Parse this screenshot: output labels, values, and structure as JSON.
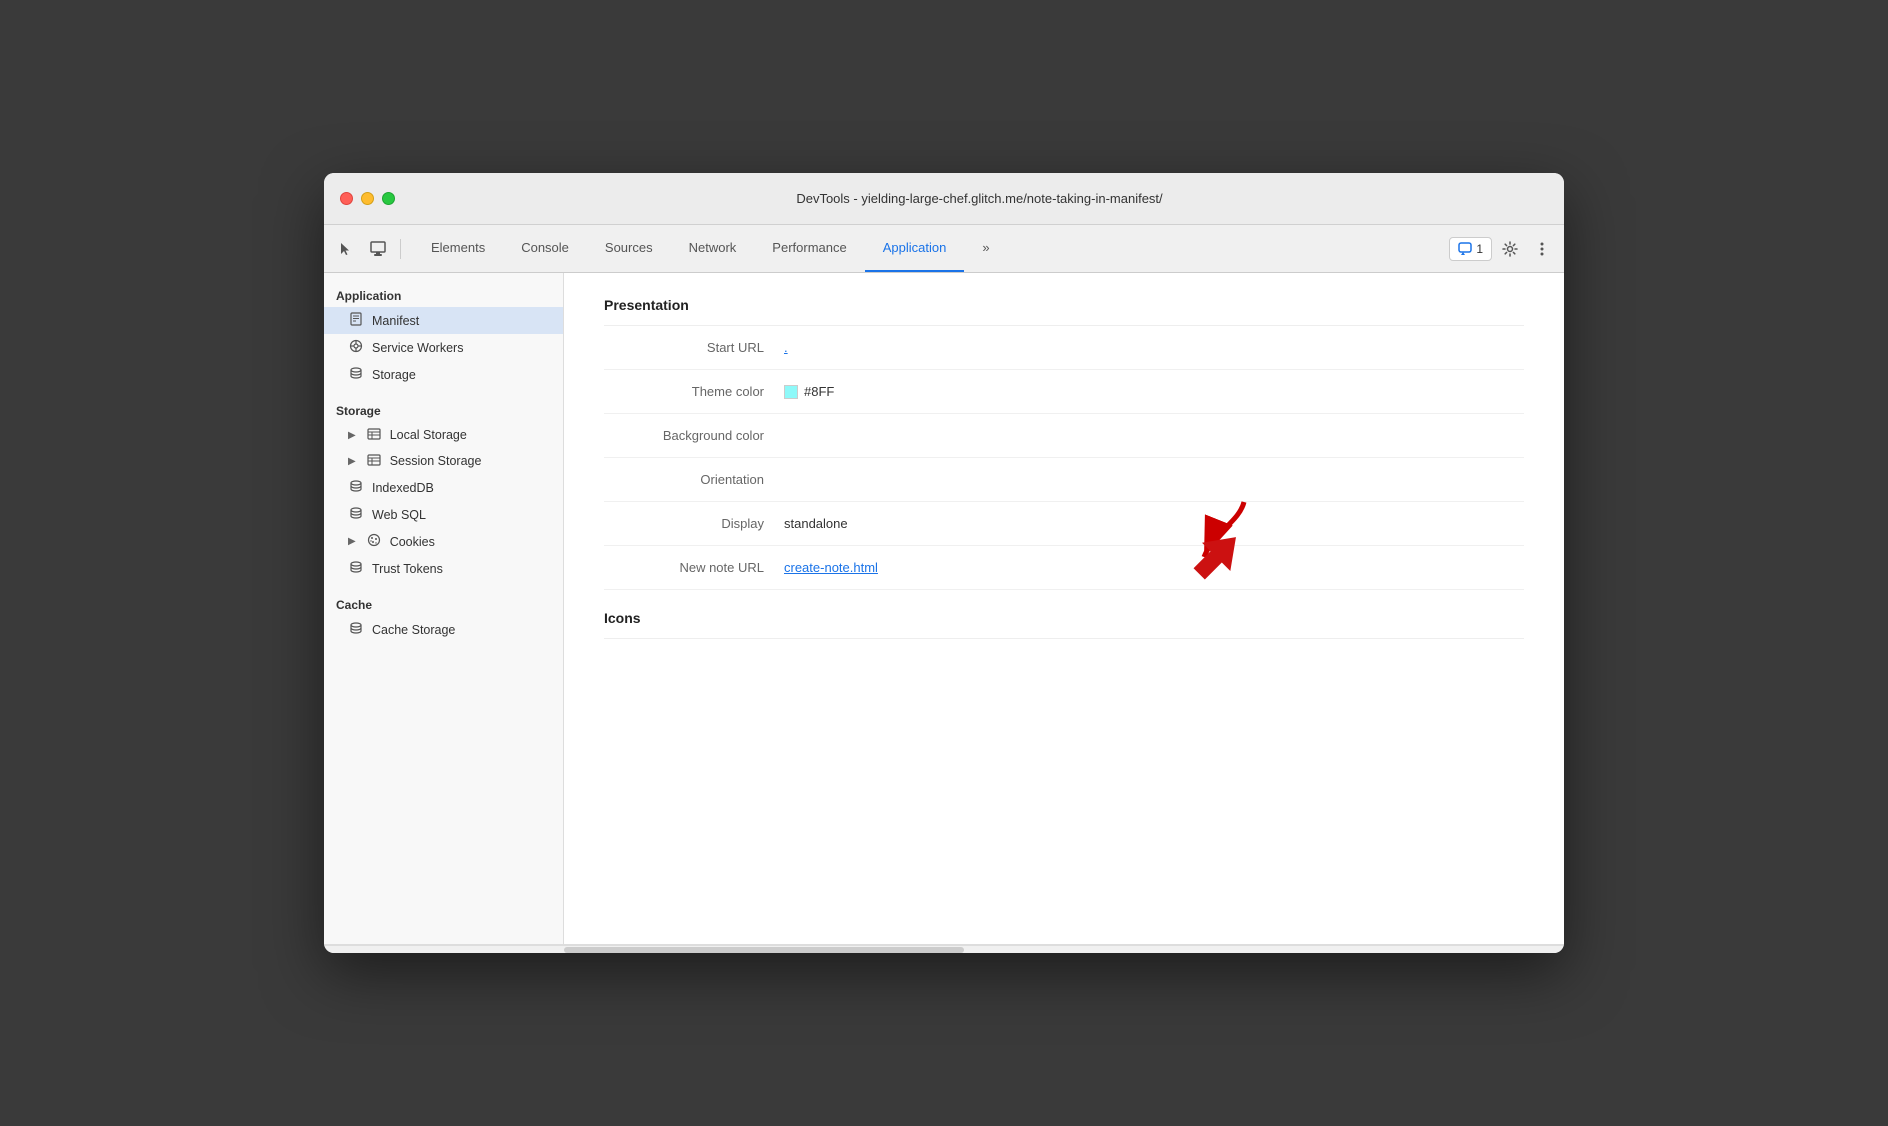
{
  "window": {
    "title": "DevTools - yielding-large-chef.glitch.me/note-taking-in-manifest/"
  },
  "toolbar": {
    "tabs": [
      {
        "id": "elements",
        "label": "Elements",
        "active": false
      },
      {
        "id": "console",
        "label": "Console",
        "active": false
      },
      {
        "id": "sources",
        "label": "Sources",
        "active": false
      },
      {
        "id": "network",
        "label": "Network",
        "active": false
      },
      {
        "id": "performance",
        "label": "Performance",
        "active": false
      },
      {
        "id": "application",
        "label": "Application",
        "active": true
      }
    ],
    "comments_count": "1",
    "more_label": "»"
  },
  "sidebar": {
    "sections": [
      {
        "id": "application",
        "label": "Application",
        "items": [
          {
            "id": "manifest",
            "label": "Manifest",
            "icon": "📄",
            "active": true,
            "indent": 1
          },
          {
            "id": "service-workers",
            "label": "Service Workers",
            "icon": "⚙️",
            "active": false,
            "indent": 1
          },
          {
            "id": "storage-app",
            "label": "Storage",
            "icon": "🗄️",
            "active": false,
            "indent": 1
          }
        ]
      },
      {
        "id": "storage",
        "label": "Storage",
        "items": [
          {
            "id": "local-storage",
            "label": "Local Storage",
            "icon": "▦",
            "active": false,
            "expandable": true,
            "indent": 1
          },
          {
            "id": "session-storage",
            "label": "Session Storage",
            "icon": "▦",
            "active": false,
            "expandable": true,
            "indent": 1
          },
          {
            "id": "indexeddb",
            "label": "IndexedDB",
            "icon": "🗄️",
            "active": false,
            "indent": 1
          },
          {
            "id": "web-sql",
            "label": "Web SQL",
            "icon": "🗄️",
            "active": false,
            "indent": 1
          },
          {
            "id": "cookies",
            "label": "Cookies",
            "icon": "🍪",
            "active": false,
            "expandable": true,
            "indent": 1
          },
          {
            "id": "trust-tokens",
            "label": "Trust Tokens",
            "icon": "🗄️",
            "active": false,
            "indent": 1
          }
        ]
      },
      {
        "id": "cache",
        "label": "Cache",
        "items": [
          {
            "id": "cache-storage",
            "label": "Cache Storage",
            "icon": "🗄️",
            "active": false,
            "indent": 1
          }
        ]
      }
    ]
  },
  "panel": {
    "sections": [
      {
        "id": "presentation",
        "title": "Presentation",
        "fields": [
          {
            "id": "start-url",
            "label": "Start URL",
            "value": ".",
            "type": "link"
          },
          {
            "id": "theme-color",
            "label": "Theme color",
            "value": "#8FF",
            "color": "#8ef9f9",
            "type": "color"
          },
          {
            "id": "background-color",
            "label": "Background color",
            "value": "",
            "type": "text"
          },
          {
            "id": "orientation",
            "label": "Orientation",
            "value": "",
            "type": "text"
          },
          {
            "id": "display",
            "label": "Display",
            "value": "standalone",
            "type": "text"
          },
          {
            "id": "new-note-url",
            "label": "New note URL",
            "value": "create-note.html",
            "type": "link"
          }
        ]
      },
      {
        "id": "icons",
        "title": "Icons"
      }
    ]
  }
}
